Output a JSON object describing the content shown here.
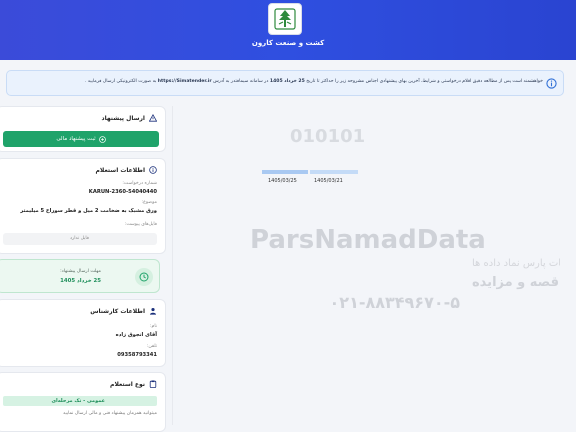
{
  "header": {
    "title": "کشت و صنعت کارون"
  },
  "notice": {
    "text_before": "خواهشمند است پس از مطالعه دقیق اقلام درخواستی و شرایط، آخرین بهای پیشنهادی اجناس مشروحه زیر را حداکثر تا تاریخ",
    "deadline": "25 خرداد 1405",
    "text_middle": "در سامانه سیمافتدر به آدرس",
    "url": "https://Simatender.ir",
    "text_after": "به صورت الکترونیکی ارسال فرمایید ."
  },
  "send_offer": {
    "title": "ارسال پیشنهاد",
    "button_label": "ثبت پیشنهاد مالی"
  },
  "inquiry": {
    "title": "اطلاعات استعلام",
    "request_number_label": "شماره درخواست:",
    "request_number": "KARUN-2360-54040440",
    "subject_label": "موضوع:",
    "subject": "ورق مشبک به ضخامت 2 میل و قطر سوراخ 5 میلیمتر",
    "attachments_label": "فایل‌های پیوست:",
    "attachments_value": "فایل ندارد"
  },
  "deadline_card": {
    "label": "مهلت ارسال پیشنهاد:",
    "value": "25 خرداد 1405"
  },
  "expert": {
    "title": "اطلاعات کارشناس",
    "name_label": "نام:",
    "name": "آقای انجوق زاده",
    "phone_label": "تلفن:",
    "phone": "09358793341"
  },
  "inquiry_type": {
    "title": "نوع استعلام",
    "badge": "عمومی - تک مرحله‌ای",
    "note": "میتوانید همزمان پیشنهاد فنی و مالی ارسال نمایید"
  },
  "timeline": {
    "start_date": "1405/03/21",
    "end_date": "1405/03/25"
  },
  "watermark": {
    "brand": "ParsNamadData",
    "digits": "010101",
    "line1": "مرکز فناوری اطلاعات پارس نماد داده ها",
    "line2": "پایگاه اطلاع رسانی مناقصه و مزایده",
    "phone": "۰۲۱-۸۸۳۴۹۶۷۰-۵"
  },
  "colors": {
    "header": "#2f4fe0",
    "accent_green": "#1fa36a",
    "notice_bg": "#eaf2fd"
  }
}
